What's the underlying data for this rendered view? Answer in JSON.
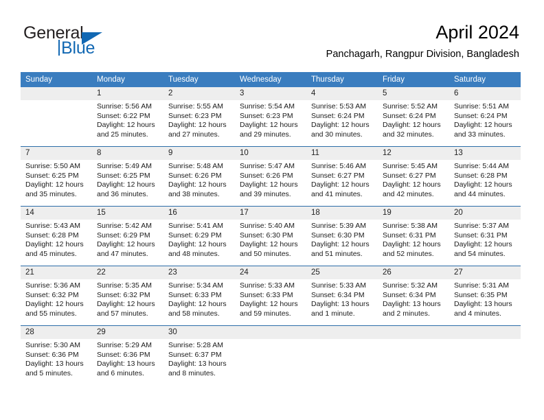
{
  "brand": {
    "name_part1": "General",
    "name_part2": "Blue",
    "accent_color": "#1268b3"
  },
  "header": {
    "title": "April 2024",
    "subtitle": "Panchagarh, Rangpur Division, Bangladesh"
  },
  "calendar": {
    "header_bg": "#3a7dbf",
    "daynum_bg": "#eeeeee",
    "row_divider": "#2b6ca8",
    "weekday_headers": [
      "Sunday",
      "Monday",
      "Tuesday",
      "Wednesday",
      "Thursday",
      "Friday",
      "Saturday"
    ],
    "weeks": [
      [
        {
          "day": "",
          "empty": true
        },
        {
          "day": "1",
          "sunrise": "Sunrise: 5:56 AM",
          "sunset": "Sunset: 6:22 PM",
          "daylight1": "Daylight: 12 hours",
          "daylight2": "and 25 minutes."
        },
        {
          "day": "2",
          "sunrise": "Sunrise: 5:55 AM",
          "sunset": "Sunset: 6:23 PM",
          "daylight1": "Daylight: 12 hours",
          "daylight2": "and 27 minutes."
        },
        {
          "day": "3",
          "sunrise": "Sunrise: 5:54 AM",
          "sunset": "Sunset: 6:23 PM",
          "daylight1": "Daylight: 12 hours",
          "daylight2": "and 29 minutes."
        },
        {
          "day": "4",
          "sunrise": "Sunrise: 5:53 AM",
          "sunset": "Sunset: 6:24 PM",
          "daylight1": "Daylight: 12 hours",
          "daylight2": "and 30 minutes."
        },
        {
          "day": "5",
          "sunrise": "Sunrise: 5:52 AM",
          "sunset": "Sunset: 6:24 PM",
          "daylight1": "Daylight: 12 hours",
          "daylight2": "and 32 minutes."
        },
        {
          "day": "6",
          "sunrise": "Sunrise: 5:51 AM",
          "sunset": "Sunset: 6:24 PM",
          "daylight1": "Daylight: 12 hours",
          "daylight2": "and 33 minutes."
        }
      ],
      [
        {
          "day": "7",
          "sunrise": "Sunrise: 5:50 AM",
          "sunset": "Sunset: 6:25 PM",
          "daylight1": "Daylight: 12 hours",
          "daylight2": "and 35 minutes."
        },
        {
          "day": "8",
          "sunrise": "Sunrise: 5:49 AM",
          "sunset": "Sunset: 6:25 PM",
          "daylight1": "Daylight: 12 hours",
          "daylight2": "and 36 minutes."
        },
        {
          "day": "9",
          "sunrise": "Sunrise: 5:48 AM",
          "sunset": "Sunset: 6:26 PM",
          "daylight1": "Daylight: 12 hours",
          "daylight2": "and 38 minutes."
        },
        {
          "day": "10",
          "sunrise": "Sunrise: 5:47 AM",
          "sunset": "Sunset: 6:26 PM",
          "daylight1": "Daylight: 12 hours",
          "daylight2": "and 39 minutes."
        },
        {
          "day": "11",
          "sunrise": "Sunrise: 5:46 AM",
          "sunset": "Sunset: 6:27 PM",
          "daylight1": "Daylight: 12 hours",
          "daylight2": "and 41 minutes."
        },
        {
          "day": "12",
          "sunrise": "Sunrise: 5:45 AM",
          "sunset": "Sunset: 6:27 PM",
          "daylight1": "Daylight: 12 hours",
          "daylight2": "and 42 minutes."
        },
        {
          "day": "13",
          "sunrise": "Sunrise: 5:44 AM",
          "sunset": "Sunset: 6:28 PM",
          "daylight1": "Daylight: 12 hours",
          "daylight2": "and 44 minutes."
        }
      ],
      [
        {
          "day": "14",
          "sunrise": "Sunrise: 5:43 AM",
          "sunset": "Sunset: 6:28 PM",
          "daylight1": "Daylight: 12 hours",
          "daylight2": "and 45 minutes."
        },
        {
          "day": "15",
          "sunrise": "Sunrise: 5:42 AM",
          "sunset": "Sunset: 6:29 PM",
          "daylight1": "Daylight: 12 hours",
          "daylight2": "and 47 minutes."
        },
        {
          "day": "16",
          "sunrise": "Sunrise: 5:41 AM",
          "sunset": "Sunset: 6:29 PM",
          "daylight1": "Daylight: 12 hours",
          "daylight2": "and 48 minutes."
        },
        {
          "day": "17",
          "sunrise": "Sunrise: 5:40 AM",
          "sunset": "Sunset: 6:30 PM",
          "daylight1": "Daylight: 12 hours",
          "daylight2": "and 50 minutes."
        },
        {
          "day": "18",
          "sunrise": "Sunrise: 5:39 AM",
          "sunset": "Sunset: 6:30 PM",
          "daylight1": "Daylight: 12 hours",
          "daylight2": "and 51 minutes."
        },
        {
          "day": "19",
          "sunrise": "Sunrise: 5:38 AM",
          "sunset": "Sunset: 6:31 PM",
          "daylight1": "Daylight: 12 hours",
          "daylight2": "and 52 minutes."
        },
        {
          "day": "20",
          "sunrise": "Sunrise: 5:37 AM",
          "sunset": "Sunset: 6:31 PM",
          "daylight1": "Daylight: 12 hours",
          "daylight2": "and 54 minutes."
        }
      ],
      [
        {
          "day": "21",
          "sunrise": "Sunrise: 5:36 AM",
          "sunset": "Sunset: 6:32 PM",
          "daylight1": "Daylight: 12 hours",
          "daylight2": "and 55 minutes."
        },
        {
          "day": "22",
          "sunrise": "Sunrise: 5:35 AM",
          "sunset": "Sunset: 6:32 PM",
          "daylight1": "Daylight: 12 hours",
          "daylight2": "and 57 minutes."
        },
        {
          "day": "23",
          "sunrise": "Sunrise: 5:34 AM",
          "sunset": "Sunset: 6:33 PM",
          "daylight1": "Daylight: 12 hours",
          "daylight2": "and 58 minutes."
        },
        {
          "day": "24",
          "sunrise": "Sunrise: 5:33 AM",
          "sunset": "Sunset: 6:33 PM",
          "daylight1": "Daylight: 12 hours",
          "daylight2": "and 59 minutes."
        },
        {
          "day": "25",
          "sunrise": "Sunrise: 5:33 AM",
          "sunset": "Sunset: 6:34 PM",
          "daylight1": "Daylight: 13 hours",
          "daylight2": "and 1 minute."
        },
        {
          "day": "26",
          "sunrise": "Sunrise: 5:32 AM",
          "sunset": "Sunset: 6:34 PM",
          "daylight1": "Daylight: 13 hours",
          "daylight2": "and 2 minutes."
        },
        {
          "day": "27",
          "sunrise": "Sunrise: 5:31 AM",
          "sunset": "Sunset: 6:35 PM",
          "daylight1": "Daylight: 13 hours",
          "daylight2": "and 4 minutes."
        }
      ],
      [
        {
          "day": "28",
          "sunrise": "Sunrise: 5:30 AM",
          "sunset": "Sunset: 6:36 PM",
          "daylight1": "Daylight: 13 hours",
          "daylight2": "and 5 minutes."
        },
        {
          "day": "29",
          "sunrise": "Sunrise: 5:29 AM",
          "sunset": "Sunset: 6:36 PM",
          "daylight1": "Daylight: 13 hours",
          "daylight2": "and 6 minutes."
        },
        {
          "day": "30",
          "sunrise": "Sunrise: 5:28 AM",
          "sunset": "Sunset: 6:37 PM",
          "daylight1": "Daylight: 13 hours",
          "daylight2": "and 8 minutes."
        },
        {
          "day": "",
          "empty": true
        },
        {
          "day": "",
          "empty": true
        },
        {
          "day": "",
          "empty": true
        },
        {
          "day": "",
          "empty": true
        }
      ]
    ]
  }
}
